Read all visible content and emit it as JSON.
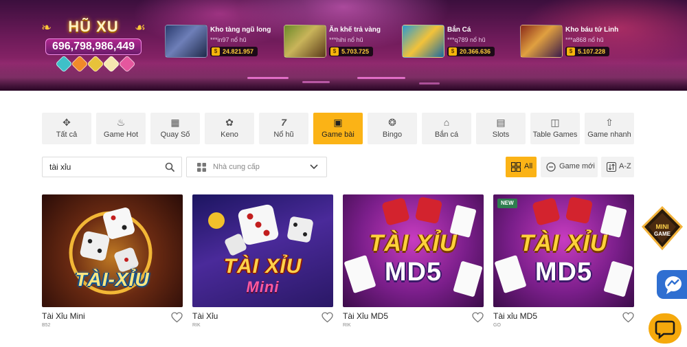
{
  "jackpot": {
    "title": "HŨ XU",
    "amount": "696,798,986,449"
  },
  "jackpot_winners": [
    {
      "game": "Kho tàng ngũ long",
      "user": "***in97",
      "action": "nổ hũ",
      "prize": "24.821.957"
    },
    {
      "game": "Ăn khế trả vàng",
      "user": "***hihi",
      "action": "nổ hũ",
      "prize": "5.703.725"
    },
    {
      "game": "Bắn Cá",
      "user": "***q789",
      "action": "nổ hũ",
      "prize": "20.366.636"
    },
    {
      "game": "Kho báu tứ Linh",
      "user": "***a868",
      "action": "nổ hũ",
      "prize": "5.107.228"
    }
  ],
  "tabs": [
    {
      "label": "Tất cả",
      "icon": "gamepad-icon"
    },
    {
      "label": "Game Hot",
      "icon": "flame-icon"
    },
    {
      "label": "Quay Số",
      "icon": "lottery-icon"
    },
    {
      "label": "Keno",
      "icon": "keno-icon"
    },
    {
      "label": "Nổ hũ",
      "icon": "slot-seven-icon"
    },
    {
      "label": "Game bài",
      "icon": "cards-icon",
      "active": true
    },
    {
      "label": "Bingo",
      "icon": "bingo-icon"
    },
    {
      "label": "Bắn cá",
      "icon": "fish-icon"
    },
    {
      "label": "Slots",
      "icon": "slots-icon"
    },
    {
      "label": "Table Games",
      "icon": "table-icon"
    },
    {
      "label": "Game nhanh",
      "icon": "rocket-icon"
    }
  ],
  "search": {
    "value": "tài xỉu"
  },
  "provider_filter": {
    "placeholder": "Nhà cung cấp"
  },
  "sort": {
    "all_label": "All",
    "new_label": "Game mới",
    "az_label": "A-Z"
  },
  "games": [
    {
      "name": "Tài Xỉu Mini",
      "provider": "B52",
      "art_title": "TÀI-XỈU",
      "new": false
    },
    {
      "name": "Tài Xỉu",
      "provider": "RIK",
      "art_title": "TÀI XỈU",
      "art_subtitle": "Mini",
      "new": false
    },
    {
      "name": "Tài Xỉu MD5",
      "provider": "RIK",
      "art_title": "TÀI XỈU",
      "art_subtitle": "MD5",
      "new": false
    },
    {
      "name": "Tài xỉu MD5",
      "provider": "GO",
      "art_title": "TÀI XỈU",
      "art_subtitle": "MD5",
      "new": true,
      "badge": "NEW"
    }
  ],
  "widgets": {
    "mini_game_label": "MINI GAME"
  },
  "colors": {
    "accent": "#fbb316",
    "tab_bg": "#f2f2f2",
    "banner_purple": "#6b1a58"
  }
}
